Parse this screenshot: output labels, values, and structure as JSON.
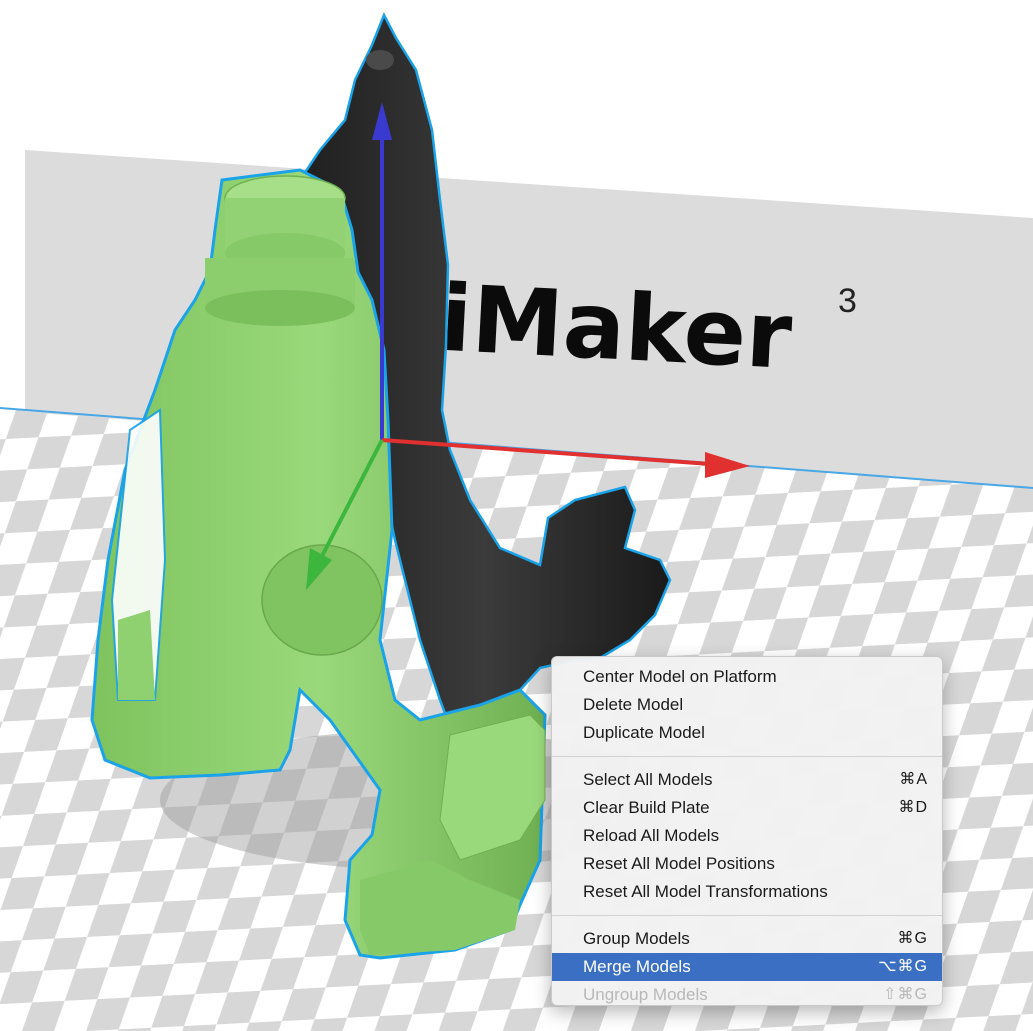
{
  "backdrop": {
    "brand_text": "iMaker",
    "brand_superscript": "3"
  },
  "colors": {
    "plate_light": "#ffffff",
    "plate_dark": "#d7d7d7",
    "backdrop_wall": "#d9d9d9",
    "selected_model": "#8fd070",
    "selected_outline": "#1aa3e8",
    "other_model": "#2b2b2b",
    "axis_x": "#e03030",
    "axis_y": "#3a3ad0",
    "axis_z": "#3cb63c",
    "menu_highlight": "#3b6fc4"
  },
  "icons": {
    "x_axis": "x-axis-arrow",
    "y_axis": "y-axis-arrow",
    "z_axis": "z-axis-arrow"
  },
  "context_menu": {
    "groups": [
      [
        {
          "label": "Center Model on Platform",
          "shortcut": ""
        },
        {
          "label": "Delete Model",
          "shortcut": ""
        },
        {
          "label": "Duplicate Model",
          "shortcut": ""
        }
      ],
      [
        {
          "label": "Select All Models",
          "shortcut": "⌘A"
        },
        {
          "label": "Clear Build Plate",
          "shortcut": "⌘D"
        },
        {
          "label": "Reload All Models",
          "shortcut": ""
        },
        {
          "label": "Reset All Model Positions",
          "shortcut": ""
        },
        {
          "label": "Reset All Model Transformations",
          "shortcut": ""
        }
      ],
      [
        {
          "label": "Group Models",
          "shortcut": "⌘G"
        },
        {
          "label": "Merge Models",
          "shortcut": "⌥⌘G",
          "highlighted": true
        },
        {
          "label": "Ungroup Models",
          "shortcut": "⇧⌘G",
          "disabled": true
        }
      ]
    ]
  }
}
